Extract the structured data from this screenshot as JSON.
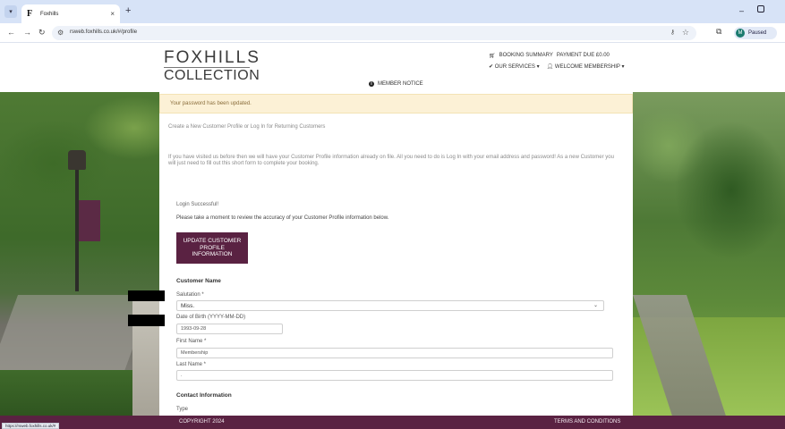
{
  "browser": {
    "tab_title": "Foxhills",
    "tab_favicon": "F",
    "url": "rsweb.foxhills.co.uk/#/profile",
    "profile_status": "Paused",
    "status_bar_url": "https://rsweb.foxhills.co.uk/#"
  },
  "header": {
    "logo_line1": "FOXHILLS",
    "logo_line2": "COLLECTION",
    "booking_summary": "BOOKING SUMMARY",
    "payment_due": "PAYMENT DUE £0.00",
    "our_services": "OUR SERVICES",
    "welcome": "WELCOME MEMBERSHIP",
    "member_notice": "MEMBER NOTICE"
  },
  "alert": {
    "text": "Your password has been updated."
  },
  "intro": {
    "title": "Create a New Customer Profile or Log In for Returning Customers",
    "body": "If you have visited us before then we will have your Customer Profile information already on file. All you need to do is Log In with your email address and password! As a new Customer you will just need to fill out this short form to complete your booking."
  },
  "login": {
    "success": "Login Successful!",
    "review": "Please take a moment to review the accuracy of your Customer Profile information below.",
    "update_button": "UPDATE CUSTOMER PROFILE INFORMATION"
  },
  "customer_name": {
    "heading": "Customer Name",
    "salutation_label": "Salutation *",
    "salutation_value": "Miss.",
    "dob_label": "Date of Birth (YYYY-MM-DD)",
    "dob_value": "1993-09-28",
    "first_name_label": "First Name *",
    "first_name_value": "Membership",
    "last_name_label": "Last Name *",
    "last_name_value": "."
  },
  "contact": {
    "heading": "Contact Information",
    "type_label": "Type"
  },
  "footer": {
    "copyright": "COPYRIGHT 2024",
    "terms": "TERMS AND CONDITIONS"
  },
  "colors": {
    "brand_purple": "#5a2242",
    "alert_bg": "#fcf1d6",
    "alert_text": "#8a6d3b"
  },
  "icons": [
    "chevron-down-icon",
    "close-icon",
    "plus-icon",
    "back-icon",
    "forward-icon",
    "reload-icon",
    "site-settings-icon",
    "key-icon",
    "star-icon",
    "extensions-icon",
    "cart-icon",
    "check-icon",
    "user-icon",
    "info-icon"
  ]
}
